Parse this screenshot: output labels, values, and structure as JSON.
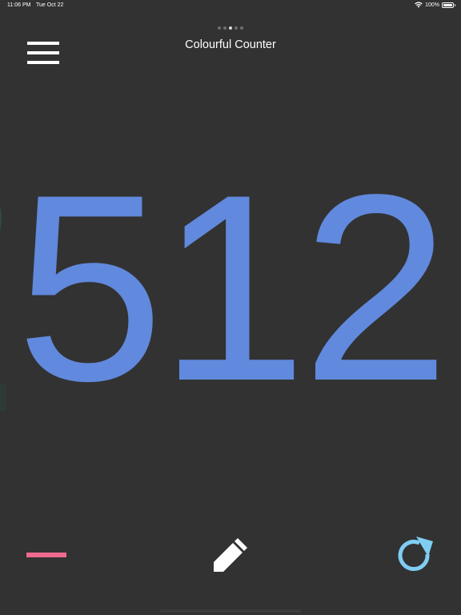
{
  "status_bar": {
    "time": "11:06 PM",
    "date": "Tue Oct 22",
    "battery": "100%",
    "battery_level": 1.0
  },
  "pager": {
    "count": 5,
    "active_index": 2
  },
  "header": {
    "title": "Colourful Counter"
  },
  "counter": {
    "value": "512",
    "color": "#6189dd"
  },
  "controls": {
    "decrement_color": "#ee6a8e",
    "edit_color": "#ffffff",
    "reset_color": "#7fcdf3"
  },
  "icons": {
    "menu": "hamburger-menu-icon",
    "decrement": "minus-icon",
    "edit": "pencil-icon",
    "reset": "refresh-icon",
    "wifi": "wifi-icon",
    "battery": "battery-icon"
  },
  "colors": {
    "background": "#323232",
    "text": "#ffffff"
  }
}
